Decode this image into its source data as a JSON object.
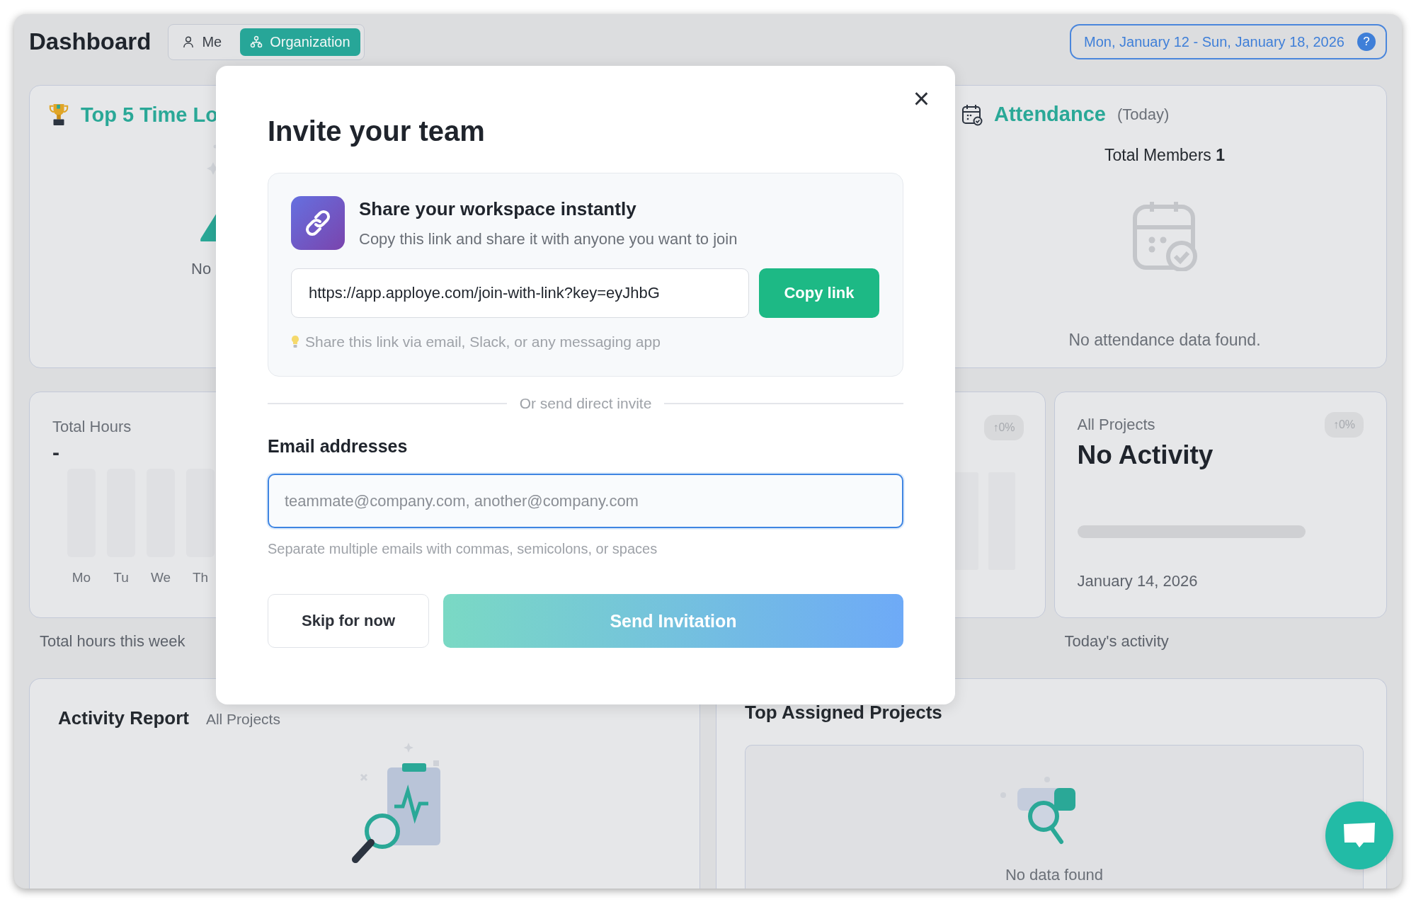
{
  "header": {
    "title": "Dashboard",
    "scope_tabs": [
      {
        "label": "Me",
        "selected": false
      },
      {
        "label": "Organization",
        "selected": true
      }
    ],
    "date_range": "Mon, January 12 - Sun, January 18, 2026",
    "help": "?"
  },
  "top_time_card": {
    "title": "Top 5 Time Lo",
    "empty_text": "No"
  },
  "attendance_card": {
    "title": "Attendance",
    "subtitle": "(Today)",
    "total": "Total Members **1**",
    "empty_text": "No attendance data found."
  },
  "stat_cards": [
    {
      "kind": "hours",
      "title": "Total Hours",
      "value": "-",
      "days": [
        "Mo",
        "Tu",
        "We",
        "Th"
      ],
      "caption": "Total hours this week"
    },
    {
      "kind": "bars",
      "badge": "↑0%"
    },
    {
      "kind": "activity",
      "title": "All Projects",
      "value": "No Activity",
      "badge": "↑0%",
      "level": 0,
      "date": "January 14, 2026",
      "caption": "Today's activity"
    }
  ],
  "activity_report": {
    "title": "Activity Report",
    "filter": "All Projects"
  },
  "top_projects": {
    "title": "Top Assigned Projects",
    "empty_text": "No data found"
  },
  "modal": {
    "title": "Invite your team",
    "close": "×",
    "share": {
      "heading": "Share your workspace instantly",
      "text": "Copy this link and share it with anyone you want to join",
      "link": "https://app.apploye.com/join-with-link?key=eyJhbG",
      "copy_button": "Copy link",
      "hint": "Share this link via email, Slack, or any messaging app"
    },
    "divider": "Or send direct invite",
    "email": {
      "label": "Email addresses",
      "placeholder": "teammate@company.com, another@company.com",
      "help": "Separate multiple emails with commas, semicolons, or spaces"
    },
    "skip_button": "Skip for now",
    "send_button": {
      "label": "Send Invitation",
      "disabled": true
    }
  }
}
